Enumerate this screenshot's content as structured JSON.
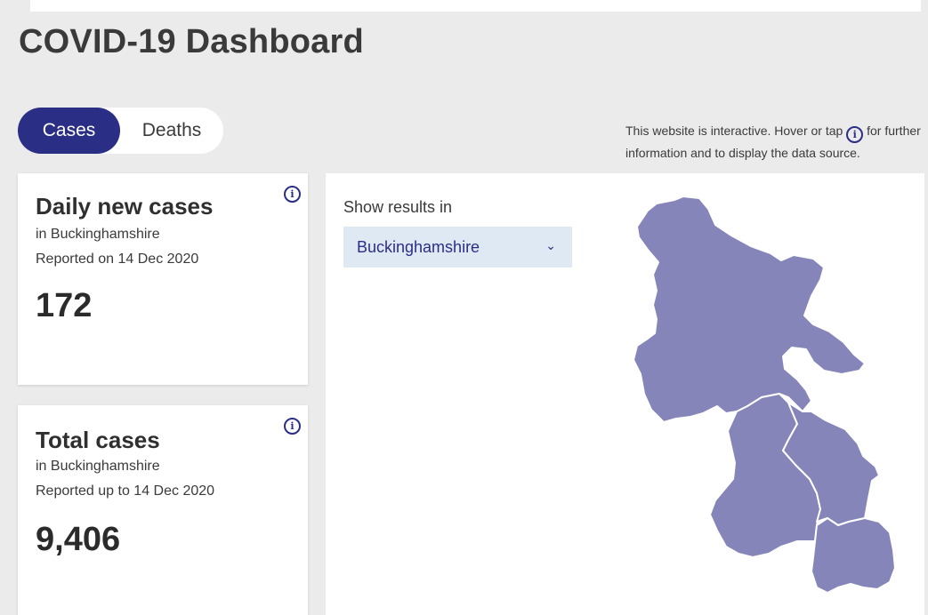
{
  "header": {
    "title": "COVID-19 Dashboard"
  },
  "toggle": {
    "options": [
      {
        "label": "Cases",
        "active": true
      },
      {
        "label": "Deaths",
        "active": false
      }
    ]
  },
  "note": {
    "text_before": "This website is interactive. Hover or tap",
    "icon": "info-icon",
    "text_after": "for further information and to display the data source."
  },
  "cards": [
    {
      "title": "Daily new cases",
      "location": "in Buckinghamshire",
      "date_line": "Reported on 14 Dec 2020",
      "value": "172"
    },
    {
      "title": "Total cases",
      "location": "in Buckinghamshire",
      "date_line": "Reported up to 14 Dec 2020",
      "value": "9,406"
    }
  ],
  "map_panel": {
    "show_label": "Show results in",
    "selected_area": "Buckinghamshire",
    "chevron_icon": "chevron-down-icon"
  },
  "colors": {
    "primary": "#2b2e85",
    "map_fill": "#8585b9",
    "select_bg": "#dfe9f4",
    "page_bg": "#ebebeb"
  }
}
